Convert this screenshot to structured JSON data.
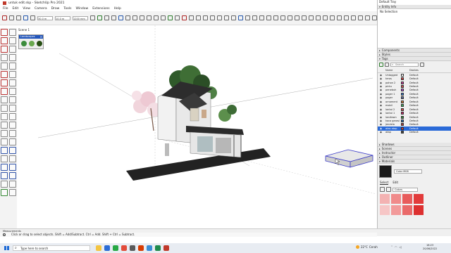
{
  "window": {
    "title": "untuk edit.skp - SketchUp Pro 2021",
    "controls": [
      "—",
      "☐",
      "✕"
    ]
  },
  "menu": [
    "File",
    "Edit",
    "View",
    "Camera",
    "Draw",
    "Tools",
    "Window",
    "Extensions",
    "Help"
  ],
  "toolbar": {
    "field1": "30.0 m",
    "field2": "10.0 m",
    "field3": "1200 mm"
  },
  "scene_tab": "Scene 1",
  "mini_panel": {
    "title": "Landscapes",
    "close": "✕"
  },
  "tray": {
    "title": "Default Tray",
    "sections_top": [
      {
        "label": "Entity Info",
        "expanded": true
      }
    ],
    "entity_info_text": "No Selection",
    "sections_mid": [
      {
        "label": "Components"
      },
      {
        "label": "Styles"
      },
      {
        "label": "Tags",
        "expanded": true
      }
    ],
    "tags_search_placeholder": "Search",
    "tags_header": {
      "name": "Name",
      "dashes": "Dashes"
    },
    "tags": [
      {
        "name": "Untagged",
        "color": "#ffffff",
        "dash": "Default"
      },
      {
        "name": "teras",
        "color": "#d63a3a",
        "dash": "Default"
      },
      {
        "name": "pohon 2",
        "color": "#cc3399",
        "dash": "Default"
      },
      {
        "name": "pintu",
        "color": "#c84444",
        "dash": "Default"
      },
      {
        "name": "penebuh",
        "color": "#aa44cc",
        "dash": "Default"
      },
      {
        "name": "pager 1",
        "color": "#3377cc",
        "dash": "Default"
      },
      {
        "name": "pager",
        "color": "#556699",
        "dash": "Default"
      },
      {
        "name": "ornament",
        "color": "#cc7733",
        "dash": "Default"
      },
      {
        "name": "mobil",
        "color": "#33aa55",
        "dash": "Default"
      },
      {
        "name": "lantai 2",
        "color": "#dd4444",
        "dash": "Default"
      },
      {
        "name": "lantai 1",
        "color": "#cc2266",
        "dash": "Default"
      },
      {
        "name": "landlawn",
        "color": "#338833",
        "dash": "Default"
      },
      {
        "name": "kaca garasi",
        "color": "#2266aa",
        "dash": "Default"
      },
      {
        "name": "jendela",
        "color": "#aa3333",
        "dash": "Default"
      },
      {
        "name": "atas atap",
        "color": "#cc3333",
        "dash": "Default",
        "selected": true
      },
      {
        "name": "atap",
        "color": "#444444",
        "dash": "Default"
      }
    ],
    "sections_bottom": [
      {
        "label": "Shadows"
      },
      {
        "label": "Scenes"
      },
      {
        "label": "Instructor"
      },
      {
        "label": "Outliner"
      },
      {
        "label": "Materials",
        "expanded": true
      }
    ],
    "materials": {
      "name": "Color M08",
      "tabs": [
        "Select",
        "Edit"
      ],
      "library": "Colors",
      "swatches": [
        "#f3b2b2",
        "#f08a8a",
        "#e85c5c",
        "#e23b3b",
        "#f6c6c6",
        "#f29a9a",
        "#ea6a6a",
        "#dd3030"
      ]
    }
  },
  "status": {
    "measurements_label": "Measurements",
    "hint": "Click or drag to select objects. Shift = Add/Subtract. Ctrl = Add. Shift + Ctrl = Subtract."
  },
  "taskbar": {
    "search_placeholder": "Type here to search",
    "weather_temp": "22°C",
    "weather_desc": "Cerah",
    "time": "18:23",
    "date": "20/06/2022",
    "app_colors": [
      "#f4c542",
      "#2b6cd6",
      "#27a844",
      "#e24b3a",
      "#5a5a5a",
      "#d83b01",
      "#3c8fd6",
      "#1f8b4c",
      "#c0392b"
    ]
  }
}
